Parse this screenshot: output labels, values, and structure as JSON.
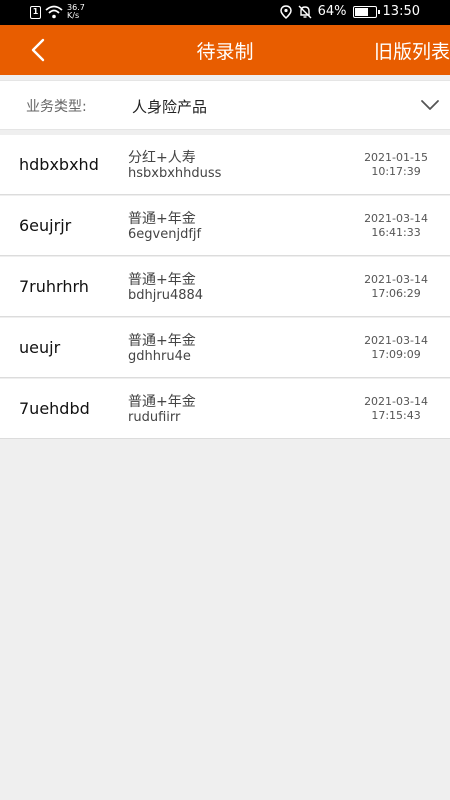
{
  "status_bar": {
    "sim": "1",
    "net_speed_value": "36.7",
    "net_speed_unit": "K/s",
    "battery": "64%",
    "time": "13:50"
  },
  "nav": {
    "title": "待录制",
    "right_action": "旧版列表"
  },
  "filter": {
    "label": "业务类型:",
    "value": "人身险产品"
  },
  "records": [
    {
      "name": "hdbxbxhd",
      "type": "分红+人寿",
      "code": "hsbxbxhhduss",
      "date": "2021-01-15",
      "time": "10:17:39"
    },
    {
      "name": "6eujrjr",
      "type": "普通+年金",
      "code": "6egvenjdfjf",
      "date": "2021-03-14",
      "time": "16:41:33"
    },
    {
      "name": "7ruhrhrh",
      "type": "普通+年金",
      "code": "bdhjru4884",
      "date": "2021-03-14",
      "time": "17:06:29"
    },
    {
      "name": "ueujr",
      "type": "普通+年金",
      "code": "gdhhru4e",
      "date": "2021-03-14",
      "time": "17:09:09"
    },
    {
      "name": "7uehdbd",
      "type": "普通+年金",
      "code": "rudufiirr",
      "date": "2021-03-14",
      "time": "17:15:43"
    }
  ],
  "colors": {
    "nav_background": "#e85d00",
    "page_background": "#efefef"
  }
}
